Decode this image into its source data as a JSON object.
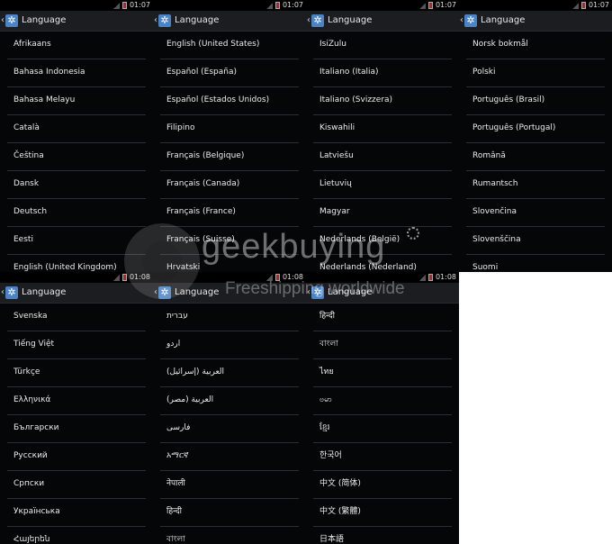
{
  "screens": [
    {
      "time": "01:07",
      "title": "Language",
      "items": [
        "Afrikaans",
        "Bahasa Indonesia",
        "Bahasa Melayu",
        "Català",
        "Čeština",
        "Dansk",
        "Deutsch",
        "Eesti",
        "English (United Kingdom)"
      ]
    },
    {
      "time": "01:07",
      "title": "Language",
      "items": [
        "English (United States)",
        "Español (España)",
        "Español (Estados Unidos)",
        "Filipino",
        "Français (Belgique)",
        "Français (Canada)",
        "Français (France)",
        "Français (Suisse)",
        "Hrvatski"
      ]
    },
    {
      "time": "01:07",
      "title": "Language",
      "items": [
        "IsiZulu",
        "Italiano (Italia)",
        "Italiano (Svizzera)",
        "Kiswahili",
        "Latviešu",
        "Lietuvių",
        "Magyar",
        "Nederlands (België)",
        "Nederlands (Nederland)"
      ]
    },
    {
      "time": "01:07",
      "title": "Language",
      "items": [
        "Norsk bokmål",
        "Polski",
        "Português (Brasil)",
        "Português (Portugal)",
        "Română",
        "Rumantsch",
        "Slovenčina",
        "Slovenščina",
        "Suomi"
      ]
    },
    {
      "time": "01:08",
      "title": "Language",
      "items": [
        "Svenska",
        "Tiếng Việt",
        "Türkçe",
        "Ελληνικά",
        "Български",
        "Русский",
        "Српски",
        "Українська",
        "Հայերեն"
      ]
    },
    {
      "time": "01:08",
      "title": "Language",
      "items": [
        "עברית",
        "اردو",
        "العربية (إسرائيل)",
        "العربية (مصر)",
        "فارسی",
        "አማርኛ",
        "नेपाली",
        "हिन्दी",
        "বাংলা"
      ]
    },
    {
      "time": "01:08",
      "title": "Language",
      "items": [
        "हिन्दी",
        "বাংলা",
        "ไทย",
        "ဗမာ",
        "ខ្មែរ",
        "한국어",
        "中文 (简体)",
        "中文 (繁體)",
        "日本語"
      ]
    }
  ],
  "icons": {
    "back": "chevron-left-icon",
    "settings": "gear-icon",
    "signal": "signal-icon",
    "battery": "battery-icon"
  },
  "watermark": {
    "brand": "geekbuying",
    "slogan": "Freeshipping worldwide"
  }
}
